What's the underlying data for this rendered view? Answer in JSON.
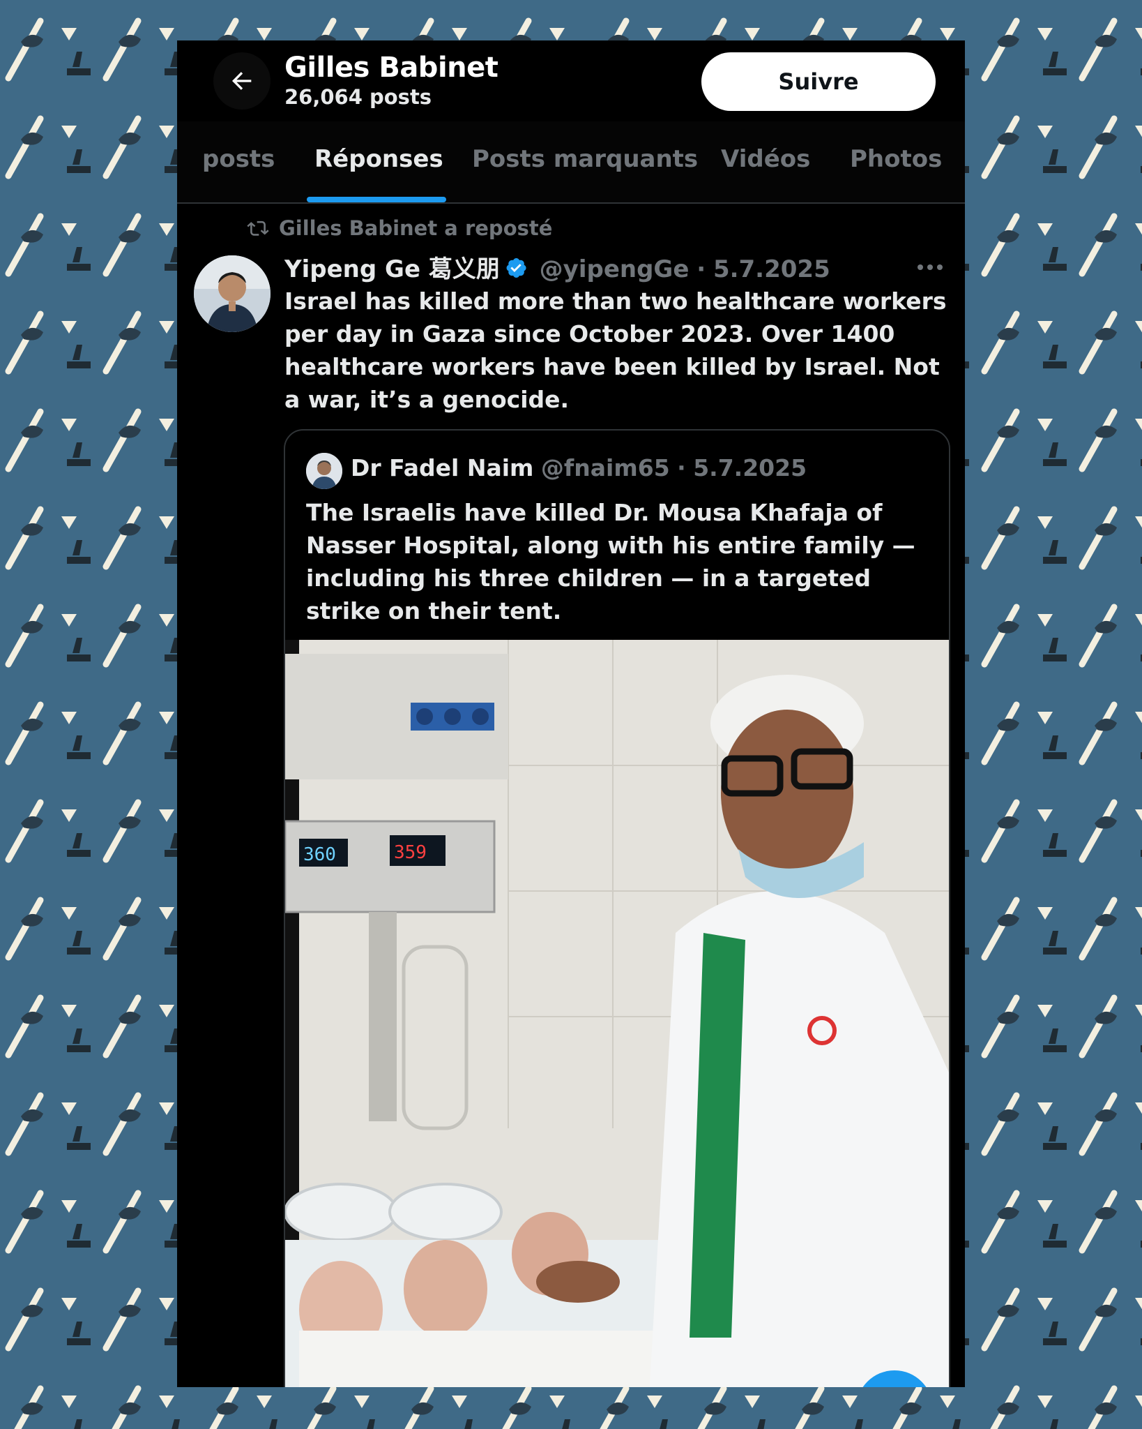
{
  "header": {
    "back_icon": "arrow-left-icon",
    "profile_name": "Gilles Babinet",
    "post_count": "26,064 posts",
    "follow_label": "Suivre"
  },
  "tabs": [
    {
      "label": "posts",
      "active": false
    },
    {
      "label": "Réponses",
      "active": true
    },
    {
      "label": "Posts marquants",
      "active": false
    },
    {
      "label": "Vidéos",
      "active": false
    },
    {
      "label": "Photos",
      "active": false
    }
  ],
  "tweet": {
    "repost_icon": "repost-icon",
    "repost_text": "Gilles Babinet a reposté",
    "author_name": "Yipeng Ge 葛义朋",
    "verified_icon": "verified-badge-icon",
    "handle": "@yipengGe",
    "date": "5.7.2025",
    "text": "Israel has killed more than two healthcare workers per day in Gaza since October 2023. Over 1400 healthcare workers have been killed by Israel. Not a war, it’s a genocide.",
    "quote": {
      "author_name": "Dr Fadel Naim",
      "handle": "@fnaim65",
      "date": "5.7.2025",
      "text": "The Israelis have killed Dr. Mousa Khafaja of Nasser Hospital, along with his entire family — including his three children — in a targeted strike on their tent."
    }
  },
  "colors": {
    "accent": "#1d9bf0",
    "background": "#000000",
    "muted_text": "#71767b",
    "backdrop": "#3f6a87"
  }
}
